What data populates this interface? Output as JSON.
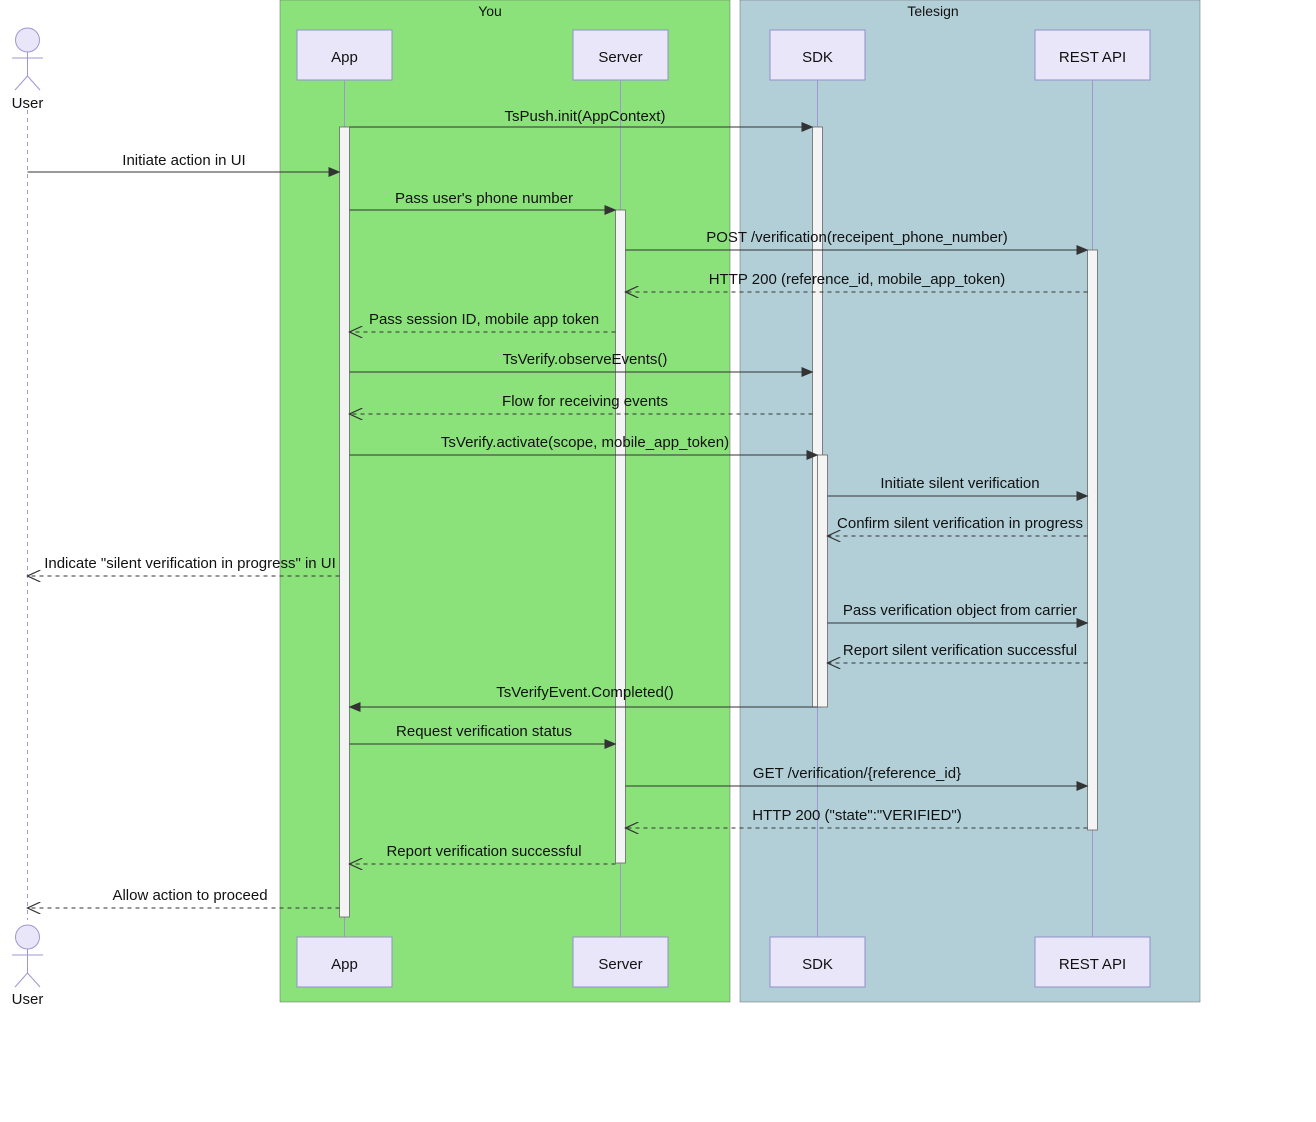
{
  "group_you_label": "You",
  "group_telesign_label": "Telesign",
  "actor_user_label": "User",
  "participant_app_label": "App",
  "participant_server_label": "Server",
  "participant_sdk_label": "SDK",
  "participant_restapi_label": "REST API",
  "chart_data": {
    "type": "sequence_diagram",
    "groups": [
      {
        "name": "You",
        "participants": [
          "App",
          "Server"
        ]
      },
      {
        "name": "Telesign",
        "participants": [
          "SDK",
          "REST API"
        ]
      }
    ],
    "participants": [
      "User",
      "App",
      "Server",
      "SDK",
      "REST API"
    ],
    "messages": [
      {
        "from": "App",
        "to": "SDK",
        "text": "TsPush.init(AppContext)",
        "style": "solid"
      },
      {
        "from": "User",
        "to": "App",
        "text": "Initiate action in UI",
        "style": "solid"
      },
      {
        "from": "App",
        "to": "Server",
        "text": "Pass user's phone number",
        "style": "solid"
      },
      {
        "from": "Server",
        "to": "REST API",
        "text": "POST /verification(receipent_phone_number)",
        "style": "solid"
      },
      {
        "from": "REST API",
        "to": "Server",
        "text": "HTTP 200 (reference_id, mobile_app_token)",
        "style": "dashed"
      },
      {
        "from": "Server",
        "to": "App",
        "text": "Pass session ID, mobile app token",
        "style": "dashed"
      },
      {
        "from": "App",
        "to": "SDK",
        "text": "TsVerify.observeEvents()",
        "style": "solid"
      },
      {
        "from": "SDK",
        "to": "App",
        "text": "Flow for receiving events",
        "style": "dashed"
      },
      {
        "from": "App",
        "to": "SDK",
        "text": "TsVerify.activate(scope, mobile_app_token)",
        "style": "solid"
      },
      {
        "from": "SDK",
        "to": "REST API",
        "text": "Initiate silent verification",
        "style": "solid"
      },
      {
        "from": "REST API",
        "to": "SDK",
        "text": "Confirm silent verification in progress",
        "style": "dashed"
      },
      {
        "from": "App",
        "to": "User",
        "text": "Indicate \"silent verification in progress\" in UI",
        "style": "dashed"
      },
      {
        "from": "SDK",
        "to": "REST API",
        "text": "Pass verification object from carrier",
        "style": "solid"
      },
      {
        "from": "REST API",
        "to": "SDK",
        "text": "Report silent verification successful",
        "style": "dashed"
      },
      {
        "from": "SDK",
        "to": "App",
        "text": "TsVerifyEvent.Completed()",
        "style": "solid"
      },
      {
        "from": "App",
        "to": "Server",
        "text": "Request verification status",
        "style": "solid"
      },
      {
        "from": "Server",
        "to": "REST API",
        "text": "GET /verification/{reference_id}",
        "style": "solid"
      },
      {
        "from": "REST API",
        "to": "Server",
        "text": "HTTP 200 (\"state\":\"VERIFIED\")",
        "style": "dashed"
      },
      {
        "from": "Server",
        "to": "App",
        "text": "Report verification successful",
        "style": "dashed"
      },
      {
        "from": "App",
        "to": "User",
        "text": "Allow action to proceed",
        "style": "dashed"
      }
    ]
  },
  "msg_1": "TsPush.init(AppContext)",
  "msg_2": "Initiate action in UI",
  "msg_3": "Pass user's phone number",
  "msg_4": "POST /verification(receipent_phone_number)",
  "msg_5": "HTTP 200 (reference_id, mobile_app_token)",
  "msg_6": "Pass session ID, mobile app token",
  "msg_7": "TsVerify.observeEvents()",
  "msg_8": "Flow for receiving events",
  "msg_9": "TsVerify.activate(scope, mobile_app_token)",
  "msg_10": "Initiate silent verification",
  "msg_11": "Confirm silent verification in progress",
  "msg_12": "Indicate \"silent verification in progress\" in UI",
  "msg_13": "Pass verification object from carrier",
  "msg_14": "Report silent verification successful",
  "msg_15": "TsVerifyEvent.Completed()",
  "msg_16": "Request verification status",
  "msg_17": "GET /verification/{reference_id}",
  "msg_18": "HTTP 200 (\"state\":\"VERIFIED\")",
  "msg_19": "Report verification successful",
  "msg_20": "Allow action to proceed"
}
